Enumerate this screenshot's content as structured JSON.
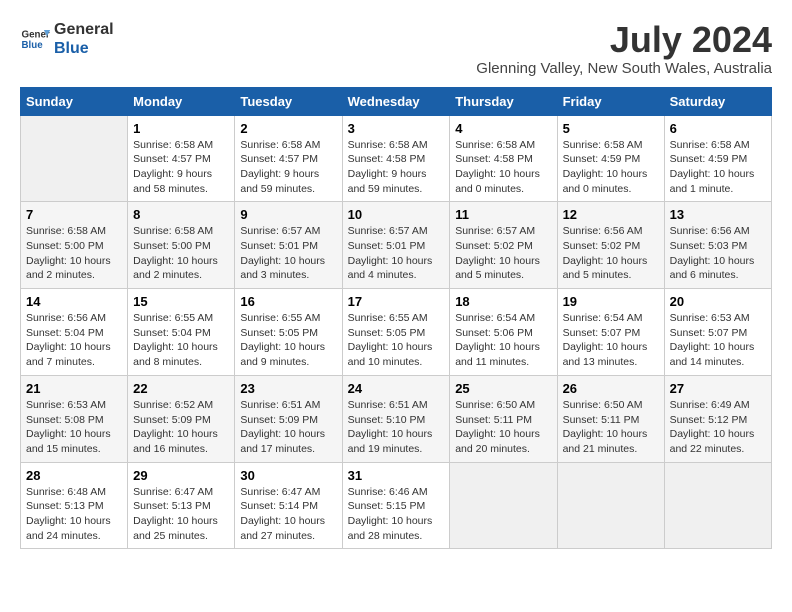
{
  "logo": {
    "line1": "General",
    "line2": "Blue"
  },
  "title": "July 2024",
  "location": "Glenning Valley, New South Wales, Australia",
  "days_header": [
    "Sunday",
    "Monday",
    "Tuesday",
    "Wednesday",
    "Thursday",
    "Friday",
    "Saturday"
  ],
  "weeks": [
    [
      {
        "day": "",
        "info": ""
      },
      {
        "day": "1",
        "info": "Sunrise: 6:58 AM\nSunset: 4:57 PM\nDaylight: 9 hours\nand 58 minutes."
      },
      {
        "day": "2",
        "info": "Sunrise: 6:58 AM\nSunset: 4:57 PM\nDaylight: 9 hours\nand 59 minutes."
      },
      {
        "day": "3",
        "info": "Sunrise: 6:58 AM\nSunset: 4:58 PM\nDaylight: 9 hours\nand 59 minutes."
      },
      {
        "day": "4",
        "info": "Sunrise: 6:58 AM\nSunset: 4:58 PM\nDaylight: 10 hours\nand 0 minutes."
      },
      {
        "day": "5",
        "info": "Sunrise: 6:58 AM\nSunset: 4:59 PM\nDaylight: 10 hours\nand 0 minutes."
      },
      {
        "day": "6",
        "info": "Sunrise: 6:58 AM\nSunset: 4:59 PM\nDaylight: 10 hours\nand 1 minute."
      }
    ],
    [
      {
        "day": "7",
        "info": "Sunrise: 6:58 AM\nSunset: 5:00 PM\nDaylight: 10 hours\nand 2 minutes."
      },
      {
        "day": "8",
        "info": "Sunrise: 6:58 AM\nSunset: 5:00 PM\nDaylight: 10 hours\nand 2 minutes."
      },
      {
        "day": "9",
        "info": "Sunrise: 6:57 AM\nSunset: 5:01 PM\nDaylight: 10 hours\nand 3 minutes."
      },
      {
        "day": "10",
        "info": "Sunrise: 6:57 AM\nSunset: 5:01 PM\nDaylight: 10 hours\nand 4 minutes."
      },
      {
        "day": "11",
        "info": "Sunrise: 6:57 AM\nSunset: 5:02 PM\nDaylight: 10 hours\nand 5 minutes."
      },
      {
        "day": "12",
        "info": "Sunrise: 6:56 AM\nSunset: 5:02 PM\nDaylight: 10 hours\nand 5 minutes."
      },
      {
        "day": "13",
        "info": "Sunrise: 6:56 AM\nSunset: 5:03 PM\nDaylight: 10 hours\nand 6 minutes."
      }
    ],
    [
      {
        "day": "14",
        "info": "Sunrise: 6:56 AM\nSunset: 5:04 PM\nDaylight: 10 hours\nand 7 minutes."
      },
      {
        "day": "15",
        "info": "Sunrise: 6:55 AM\nSunset: 5:04 PM\nDaylight: 10 hours\nand 8 minutes."
      },
      {
        "day": "16",
        "info": "Sunrise: 6:55 AM\nSunset: 5:05 PM\nDaylight: 10 hours\nand 9 minutes."
      },
      {
        "day": "17",
        "info": "Sunrise: 6:55 AM\nSunset: 5:05 PM\nDaylight: 10 hours\nand 10 minutes."
      },
      {
        "day": "18",
        "info": "Sunrise: 6:54 AM\nSunset: 5:06 PM\nDaylight: 10 hours\nand 11 minutes."
      },
      {
        "day": "19",
        "info": "Sunrise: 6:54 AM\nSunset: 5:07 PM\nDaylight: 10 hours\nand 13 minutes."
      },
      {
        "day": "20",
        "info": "Sunrise: 6:53 AM\nSunset: 5:07 PM\nDaylight: 10 hours\nand 14 minutes."
      }
    ],
    [
      {
        "day": "21",
        "info": "Sunrise: 6:53 AM\nSunset: 5:08 PM\nDaylight: 10 hours\nand 15 minutes."
      },
      {
        "day": "22",
        "info": "Sunrise: 6:52 AM\nSunset: 5:09 PM\nDaylight: 10 hours\nand 16 minutes."
      },
      {
        "day": "23",
        "info": "Sunrise: 6:51 AM\nSunset: 5:09 PM\nDaylight: 10 hours\nand 17 minutes."
      },
      {
        "day": "24",
        "info": "Sunrise: 6:51 AM\nSunset: 5:10 PM\nDaylight: 10 hours\nand 19 minutes."
      },
      {
        "day": "25",
        "info": "Sunrise: 6:50 AM\nSunset: 5:11 PM\nDaylight: 10 hours\nand 20 minutes."
      },
      {
        "day": "26",
        "info": "Sunrise: 6:50 AM\nSunset: 5:11 PM\nDaylight: 10 hours\nand 21 minutes."
      },
      {
        "day": "27",
        "info": "Sunrise: 6:49 AM\nSunset: 5:12 PM\nDaylight: 10 hours\nand 22 minutes."
      }
    ],
    [
      {
        "day": "28",
        "info": "Sunrise: 6:48 AM\nSunset: 5:13 PM\nDaylight: 10 hours\nand 24 minutes."
      },
      {
        "day": "29",
        "info": "Sunrise: 6:47 AM\nSunset: 5:13 PM\nDaylight: 10 hours\nand 25 minutes."
      },
      {
        "day": "30",
        "info": "Sunrise: 6:47 AM\nSunset: 5:14 PM\nDaylight: 10 hours\nand 27 minutes."
      },
      {
        "day": "31",
        "info": "Sunrise: 6:46 AM\nSunset: 5:15 PM\nDaylight: 10 hours\nand 28 minutes."
      },
      {
        "day": "",
        "info": ""
      },
      {
        "day": "",
        "info": ""
      },
      {
        "day": "",
        "info": ""
      }
    ]
  ]
}
